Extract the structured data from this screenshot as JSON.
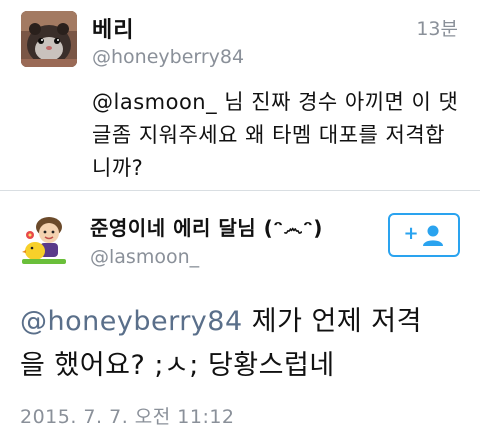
{
  "reply_tweet": {
    "display_name": "베리",
    "handle": "@honeyberry84",
    "time": "13분",
    "mention": "@lasmoon_",
    "text_line1_rest": " 님 진짜 경수 아끼면 이 댓",
    "text_line2": "글좀 지워주세요 왜 타멤 대포를 저격합",
    "text_line3": "니까?",
    "avatar_icon": "hamster-avatar-icon"
  },
  "main_tweet": {
    "display_name": "준영이네 에리 달님 (ᵔ෴ᵔ)",
    "handle": "@lasmoon_",
    "follow_icon": "add-user-icon",
    "follow_plus": "+",
    "mention": "@honeyberry84",
    "text_line1_rest": " 제가 언제 저격",
    "text_line2": "을 했어요? ;ㅅ; 당황스럽네",
    "date": "2015. 7. 7. 오전 11:12",
    "avatar_icon": "cartoon-avatar-icon"
  },
  "colors": {
    "accent": "#2aa3ef",
    "muted_text": "#8a9099",
    "mention": "#5a6f8a",
    "divider": "#d9dee2"
  }
}
